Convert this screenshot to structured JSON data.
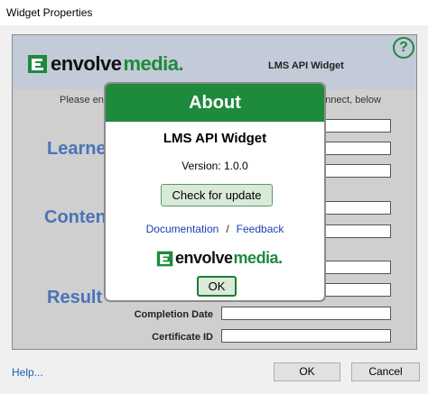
{
  "window": {
    "title": "Widget Properties"
  },
  "background": {
    "logo": {
      "part1": "envolve",
      "part2": "media."
    },
    "widget_name": "LMS API Widget",
    "instruction_left": "Please ente",
    "instruction_right": "nnect, below",
    "sections": {
      "learner": "Learne",
      "content": "Conten",
      "results": "Result"
    },
    "fields": {
      "completion_date": "Completion Date",
      "certificate_id": "Certificate ID"
    },
    "help_icon": "?"
  },
  "footer": {
    "help_link": "Help...",
    "ok_label": "OK",
    "cancel_label": "Cancel"
  },
  "about": {
    "header": "About",
    "title": "LMS API Widget",
    "version": "Version:  1.0.0",
    "update_button": "Check for update",
    "documentation_link": "Documentation",
    "separator": "/",
    "feedback_link": "Feedback",
    "logo": {
      "part1": "envolve",
      "part2": "media."
    },
    "ok_label": "OK"
  },
  "colors": {
    "brand_green": "#1e8a3c",
    "section_blue": "#4a73b8",
    "header_band": "#c3cbd9",
    "link_blue": "#1a3fb4"
  }
}
